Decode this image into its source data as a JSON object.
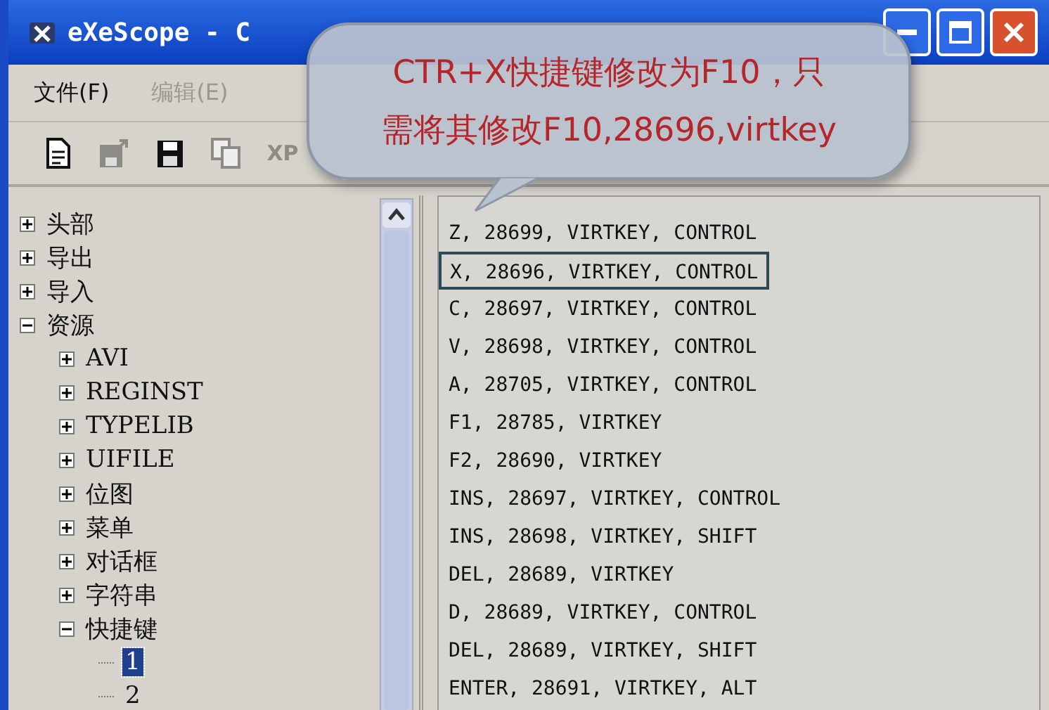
{
  "window": {
    "title": "eXeScope - C"
  },
  "menu": [
    {
      "label": "文件(F)",
      "disabled": false
    },
    {
      "label": "编辑(E)",
      "disabled": true
    }
  ],
  "toolbar": [
    {
      "kind": "page",
      "disabled": false
    },
    {
      "kind": "export",
      "disabled": true
    },
    {
      "kind": "save",
      "disabled": false
    },
    {
      "kind": "copy",
      "disabled": true
    },
    {
      "kind": "text",
      "label": "XP",
      "disabled": true
    }
  ],
  "tree": [
    {
      "label": "头部",
      "expanded": false,
      "selected": false
    },
    {
      "label": "导出",
      "expanded": false,
      "selected": false
    },
    {
      "label": "导入",
      "expanded": false,
      "selected": false
    },
    {
      "label": "资源",
      "expanded": true,
      "selected": false,
      "children": [
        {
          "label": "AVI",
          "expanded": false,
          "selected": false
        },
        {
          "label": "REGINST",
          "expanded": false,
          "selected": false
        },
        {
          "label": "TYPELIB",
          "expanded": false,
          "selected": false
        },
        {
          "label": "UIFILE",
          "expanded": false,
          "selected": false
        },
        {
          "label": "位图",
          "expanded": false,
          "selected": false
        },
        {
          "label": "菜单",
          "expanded": false,
          "selected": false
        },
        {
          "label": "对话框",
          "expanded": false,
          "selected": false
        },
        {
          "label": "字符串",
          "expanded": false,
          "selected": false
        },
        {
          "label": "快捷键",
          "expanded": true,
          "selected": false,
          "children": [
            {
              "label": "1",
              "selected": true
            },
            {
              "label": "2",
              "selected": false
            }
          ]
        }
      ]
    }
  ],
  "list": [
    {
      "text": "Z, 28699, VIRTKEY, CONTROL",
      "selected": false
    },
    {
      "text": "X, 28696, VIRTKEY, CONTROL",
      "selected": true
    },
    {
      "text": "C, 28697, VIRTKEY, CONTROL",
      "selected": false
    },
    {
      "text": "V, 28698, VIRTKEY, CONTROL",
      "selected": false
    },
    {
      "text": "A, 28705, VIRTKEY, CONTROL",
      "selected": false
    },
    {
      "text": "F1, 28785, VIRTKEY",
      "selected": false
    },
    {
      "text": "F2, 28690, VIRTKEY",
      "selected": false
    },
    {
      "text": "INS, 28697, VIRTKEY, CONTROL",
      "selected": false
    },
    {
      "text": "INS, 28698, VIRTKEY, SHIFT",
      "selected": false
    },
    {
      "text": "DEL, 28689, VIRTKEY",
      "selected": false
    },
    {
      "text": "D, 28689, VIRTKEY, CONTROL",
      "selected": false
    },
    {
      "text": "DEL, 28689, VIRTKEY, SHIFT",
      "selected": false
    },
    {
      "text": "ENTER, 28691, VIRTKEY, ALT",
      "selected": false
    }
  ],
  "callout": {
    "lines": [
      "CTR+X快捷键修改为F10，只",
      "需将其修改F10,28696,virtkey"
    ]
  }
}
